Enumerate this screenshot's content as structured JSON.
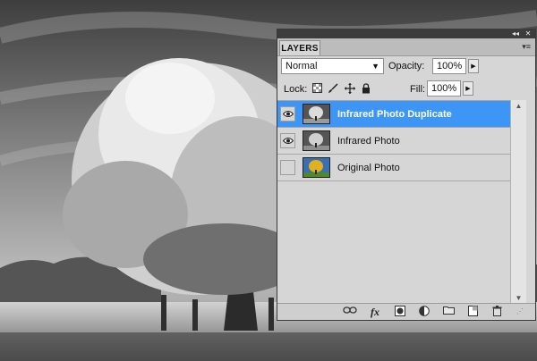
{
  "panel": {
    "tab_label": "LAYERS",
    "collapse_glyph": "◂◂",
    "close_glyph": "✕",
    "menu_glyph": "▾≡"
  },
  "blend": {
    "mode": "Normal",
    "opacity_label": "Opacity:",
    "opacity_value": "100%"
  },
  "lock": {
    "label": "Lock:",
    "fill_label": "Fill:",
    "fill_value": "100%"
  },
  "layers": [
    {
      "name": "Infrared Photo Duplicate",
      "visible": true,
      "selected": true
    },
    {
      "name": "Infrared Photo",
      "visible": true,
      "selected": false
    },
    {
      "name": "Original Photo",
      "visible": false,
      "selected": false
    }
  ],
  "bottom_buttons": [
    "link-layers-icon",
    "fx-icon",
    "layer-mask-icon",
    "adjustment-layer-icon",
    "new-group-icon",
    "new-layer-icon",
    "delete-layer-icon"
  ],
  "colors": {
    "selection": "#3d96f5",
    "panel_bg": "#d6d6d6"
  }
}
